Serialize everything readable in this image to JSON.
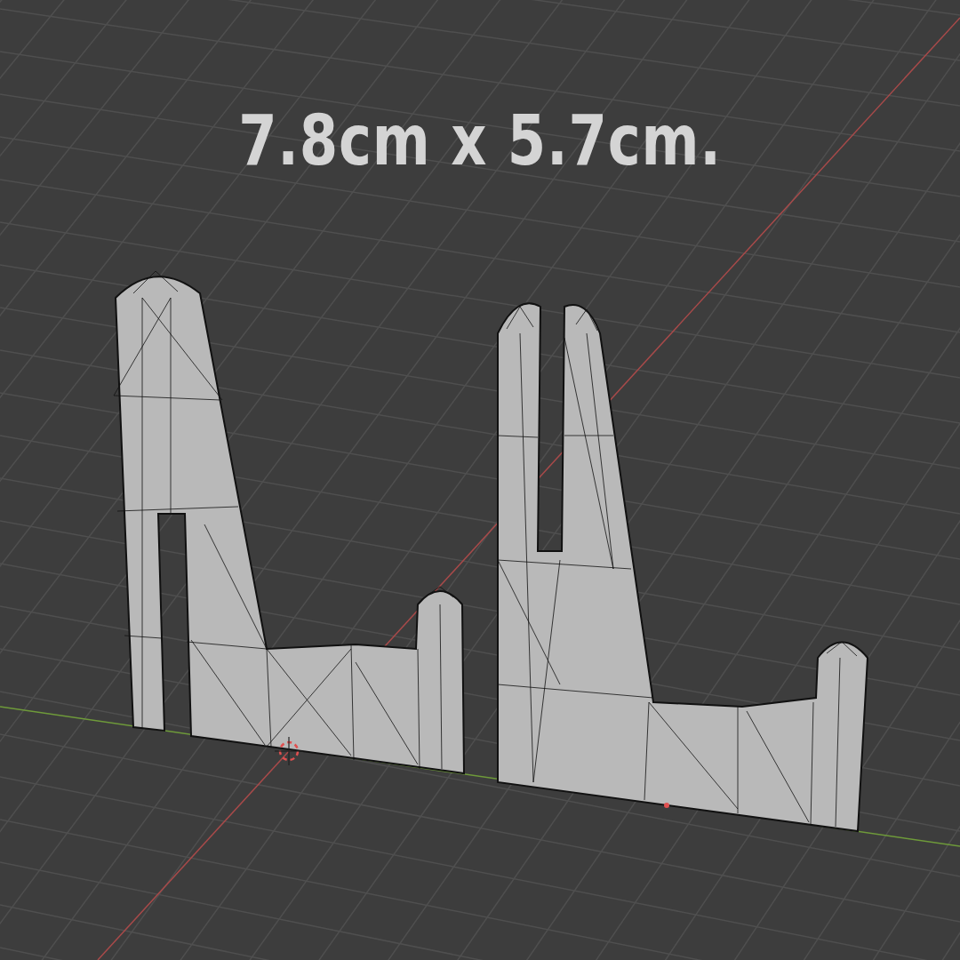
{
  "viewport": {
    "overlay_text": "7.8cm x 5.7cm."
  }
}
